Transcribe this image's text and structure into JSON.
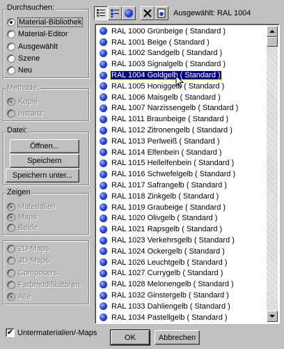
{
  "browse": {
    "title": "Durchsuchen:",
    "options": [
      {
        "label": "Material-Bibliothek",
        "checked": true
      },
      {
        "label": "Material-Editor",
        "checked": false
      },
      {
        "label": "Ausgewählt",
        "checked": false
      },
      {
        "label": "Szene",
        "checked": false
      },
      {
        "label": "Neu",
        "checked": false
      }
    ]
  },
  "method": {
    "title": "Methode:",
    "options": [
      {
        "label": "Kopie",
        "checked": true
      },
      {
        "label": "Instanz",
        "checked": false
      }
    ]
  },
  "file": {
    "title": "Datei:",
    "open_label": "Öffnen...",
    "save_label": "Speichern",
    "save_as_label": "Speichern unter..."
  },
  "show": {
    "title": "Zeigen",
    "options": [
      {
        "label": "Materialien",
        "checked": true
      },
      {
        "label": "Maps",
        "checked": true
      },
      {
        "label": "Beide",
        "checked": false
      }
    ],
    "options2": [
      {
        "label": "2D-Maps",
        "checked": false
      },
      {
        "label": "3D-Maps",
        "checked": false
      },
      {
        "label": "Composers",
        "checked": false
      },
      {
        "label": "Farbmodifikatoren",
        "checked": false
      },
      {
        "label": "Alle",
        "checked": true
      }
    ]
  },
  "toolbar": {
    "selected_text": "Ausgewählt:  RAL 1004"
  },
  "materials": [
    "RAL 1000 Grünbeige  ( Standard )",
    "RAL 1001 Beige  ( Standard )",
    "RAL 1002 Sandgelb  ( Standard )",
    "RAL 1003 Signalgelb  ( Standard )",
    "RAL 1004 Goldgelb  ( Standard )",
    "RAL 1005 Honiggelb  ( Standard )",
    "RAL 1006 Maisgelb  ( Standard )",
    "RAL 1007 Narzissengelb  ( Standard )",
    "RAL 1011 Braunbeige  ( Standard )",
    "RAL 1012 Zitronengelb  ( Standard )",
    "RAL 1013 Perlweiß  ( Standard )",
    "RAL 1014 Elfenbein  ( Standard )",
    "RAL 1015 Hellelfenbein  ( Standard )",
    "RAL 1016 Schwefelgelb  ( Standard )",
    "RAL 1017 Safrangelb  ( Standard )",
    "RAL 1018 Zinkgelb  ( Standard )",
    "RAL 1019 Graubeige  ( Standard )",
    "RAL 1020 Olivgelb  ( Standard )",
    "RAL 1021 Rapsgelb  ( Standard )",
    "RAL 1023 Verkehrsgelb  ( Standard )",
    "RAL 1024 Ockergelb  ( Standard )",
    "RAL 1026 Leuchtgelb  ( Standard )",
    "RAL 1027 Currygelb  ( Standard )",
    "RAL 1028 Melonengelb  ( Standard )",
    "RAL 1032 Ginstergelb  ( Standard )",
    "RAL 1033 Dahliengelb  ( Standard )",
    "RAL 1034 Pastellgelb  ( Standard )"
  ],
  "selected_index": 4,
  "footer": {
    "submaterials_label": "Untermaterialien/-Maps",
    "submaterials_checked": true,
    "ok_label": "OK",
    "cancel_label": "Abbrechen"
  }
}
